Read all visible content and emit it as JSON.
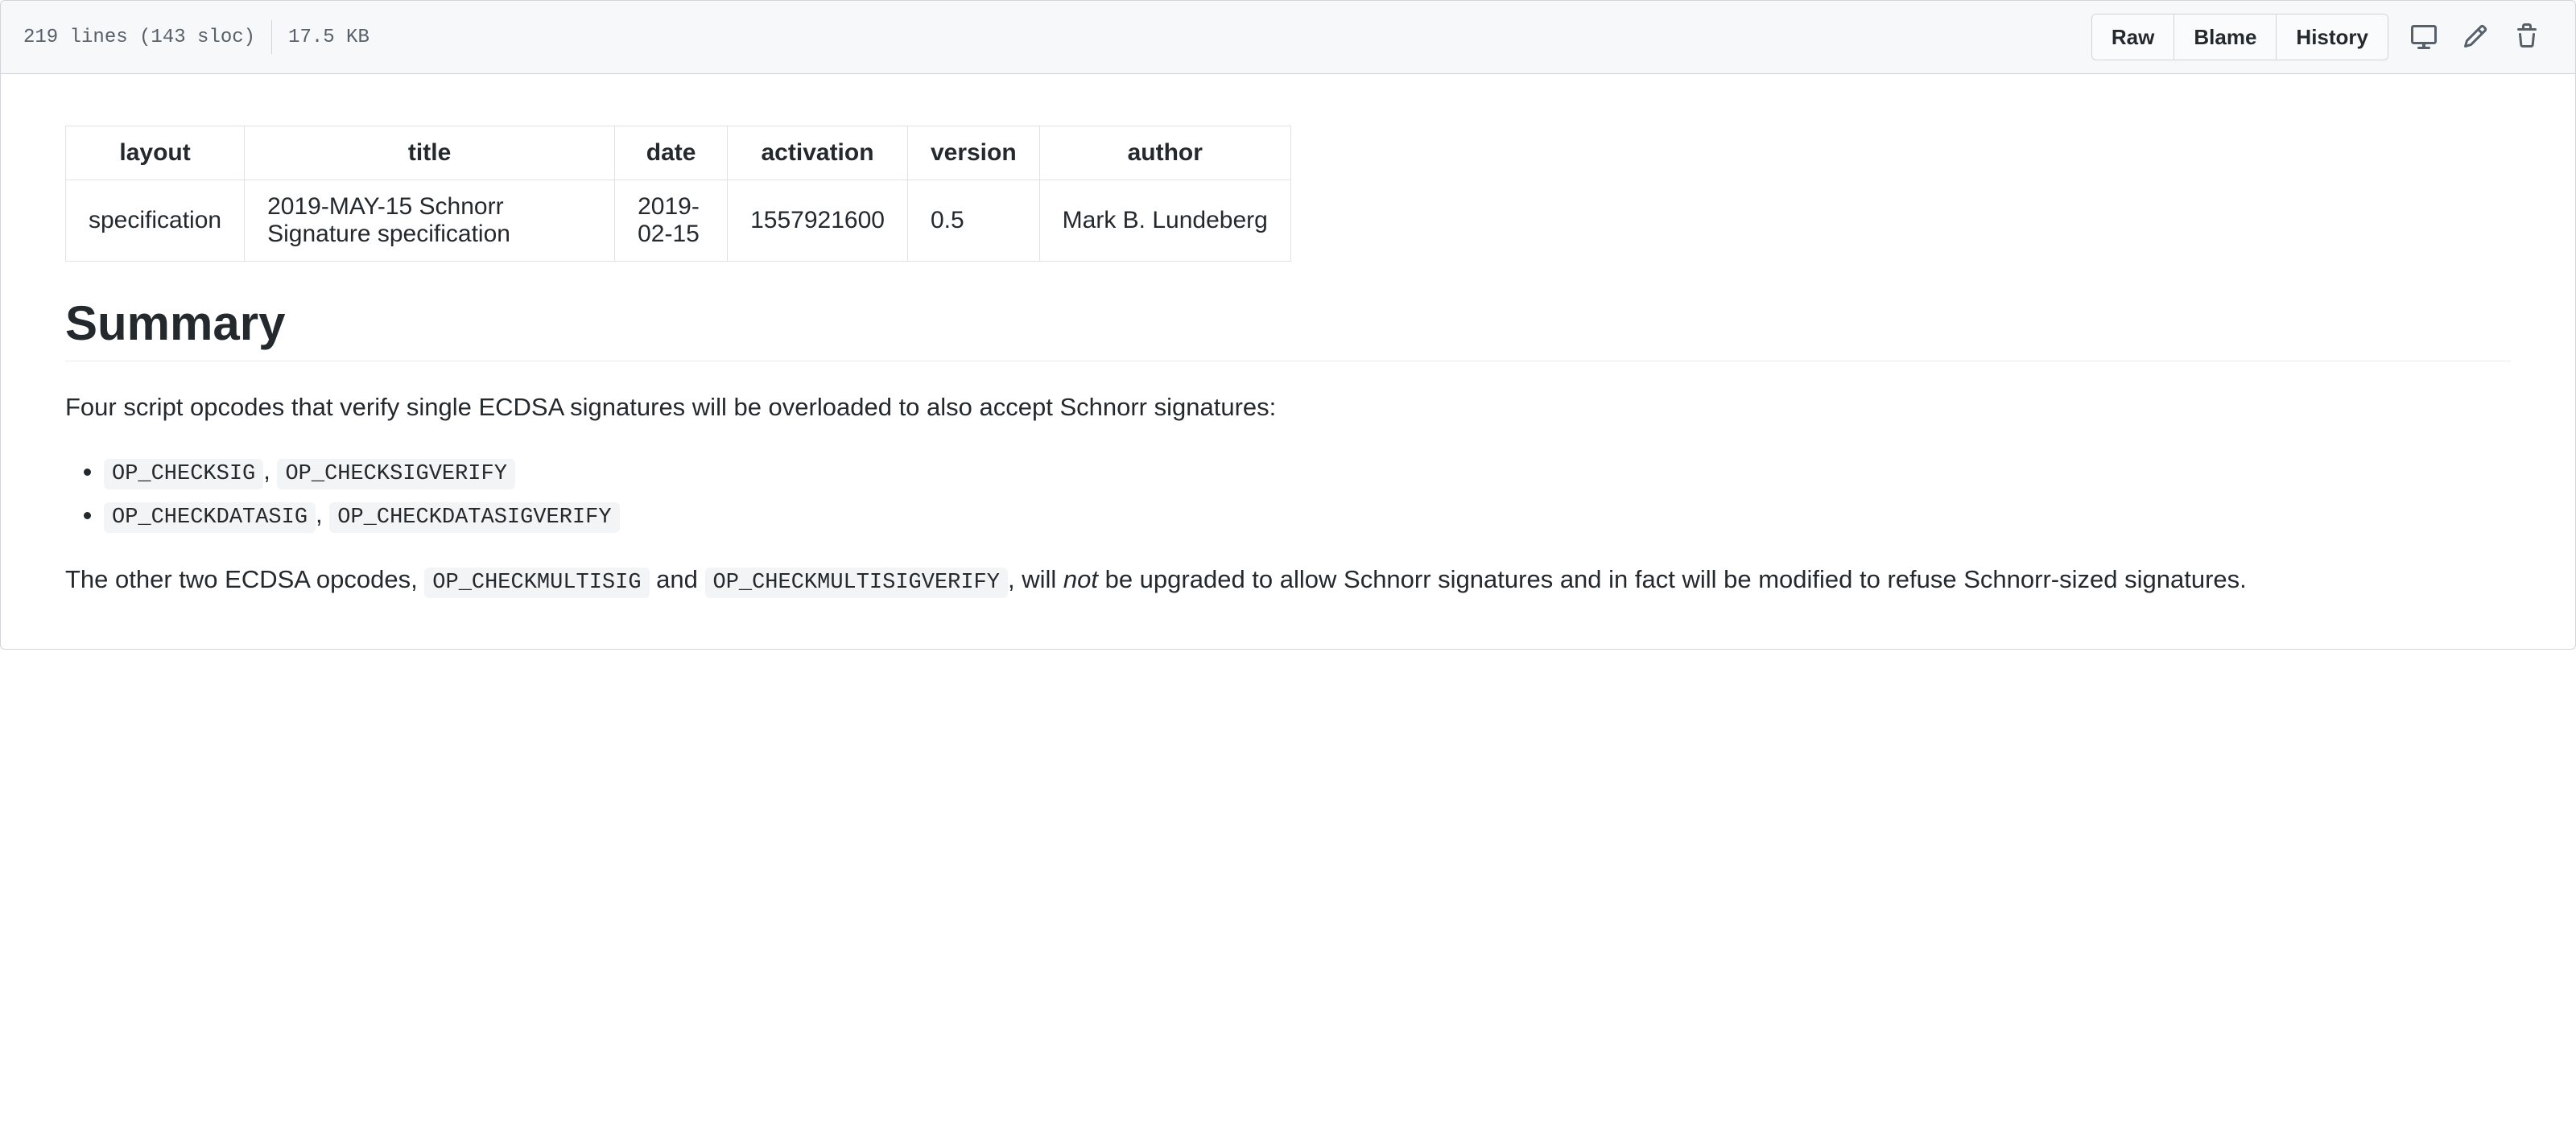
{
  "header": {
    "lines": "219 lines (143 sloc)",
    "size": "17.5 KB",
    "actions": {
      "raw": "Raw",
      "blame": "Blame",
      "history": "History"
    }
  },
  "meta": {
    "headers": {
      "layout": "layout",
      "title": "title",
      "date": "date",
      "activation": "activation",
      "version": "version",
      "author": "author"
    },
    "row": {
      "layout": "specification",
      "title": "2019-MAY-15 Schnorr Signature specification",
      "date": "2019-02-15",
      "activation": "1557921600",
      "version": "0.5",
      "author": "Mark B. Lundeberg"
    }
  },
  "content": {
    "heading": "Summary",
    "intro": "Four script opcodes that verify single ECDSA signatures will be overloaded to also accept Schnorr signatures:",
    "opcodes": {
      "a1": "OP_CHECKSIG",
      "a2": "OP_CHECKSIGVERIFY",
      "b1": "OP_CHECKDATASIG",
      "b2": "OP_CHECKDATASIGVERIFY"
    },
    "p2_1": "The other two ECDSA opcodes, ",
    "p2_c1": "OP_CHECKMULTISIG",
    "p2_2": " and ",
    "p2_c2": "OP_CHECKMULTISIGVERIFY",
    "p2_3": ", will ",
    "p2_em": "not",
    "p2_4": " be upgraded to allow Schnorr signatures and in fact will be modified to refuse Schnorr-sized signatures."
  }
}
